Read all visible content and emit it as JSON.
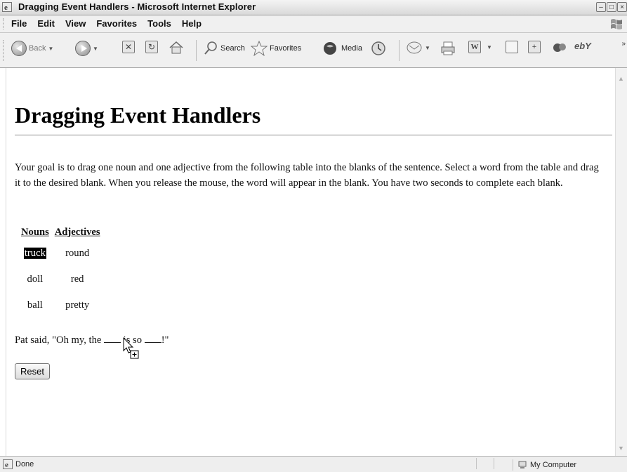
{
  "window": {
    "title": "Dragging Event Handlers - Microsoft Internet Explorer"
  },
  "menu": [
    "File",
    "Edit",
    "View",
    "Favorites",
    "Tools",
    "Help"
  ],
  "toolbar": {
    "back_label": "Back",
    "search_label": "Search",
    "favorites_label": "Favorites",
    "media_label": "Media"
  },
  "page": {
    "heading": "Dragging Event Handlers",
    "intro": "Your goal is to drag one noun and one adjective from the following table into the blanks of the sentence. Select a word from the table and drag it to the desired blank. When you release the mouse, the word will appear in the blank. You have two seconds to complete each blank.",
    "table": {
      "headers": [
        "Nouns",
        "Adjectives"
      ],
      "rows": [
        [
          "truck",
          "round"
        ],
        [
          "doll",
          "red"
        ],
        [
          "ball",
          "pretty"
        ]
      ],
      "selected_word": "truck"
    },
    "sentence": {
      "part1": "Pat said, \"Oh my, the ",
      "part2": " is so ",
      "part3": "!\""
    },
    "reset_label": "Reset"
  },
  "status": {
    "left": "Done",
    "zone": "My Computer"
  }
}
